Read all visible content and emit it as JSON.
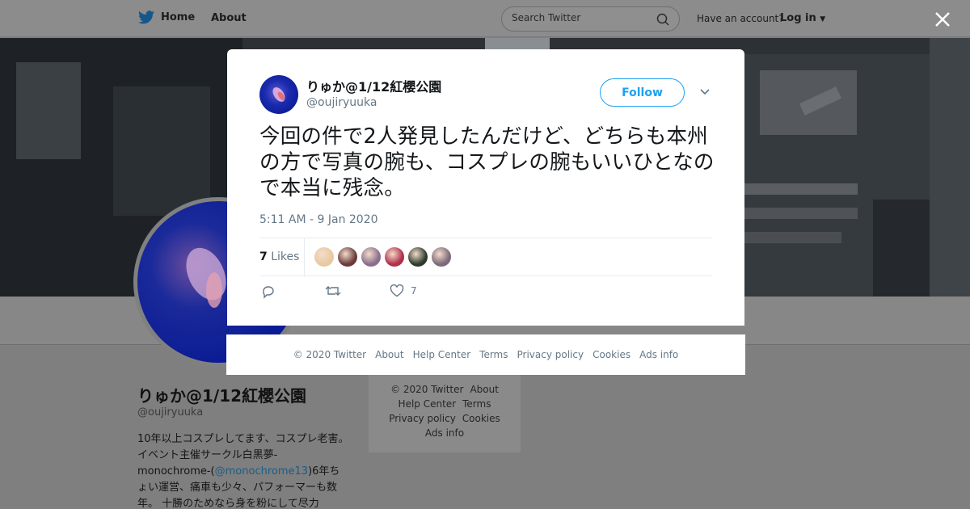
{
  "topbar": {
    "home_label": "Home",
    "about_label": "About",
    "search_placeholder": "Search Twitter",
    "account_prompt": "Have an account?",
    "login_label": "Log in"
  },
  "profile": {
    "name": "りゅか@1/12紅櫻公園",
    "handle": "@oujiryuuka",
    "bio_part1": "10年以上コスプレしてます、コスプレ老害。 イベント主催サークル白黒夢-monochrome-(",
    "bio_link": "@monochrome13",
    "bio_part2": ")6年ちょい運営、痛車も少々、パフォーマーも数年。 十勝のためなら身を粉にして尽力"
  },
  "sidebar_footer": {
    "links": [
      "© 2020 Twitter",
      "About",
      "Help Center",
      "Terms",
      "Privacy policy",
      "Cookies",
      "Ads info"
    ]
  },
  "tweet": {
    "author_name": "りゅか@1/12紅櫻公園",
    "author_handle": "@oujiryuuka",
    "follow_label": "Follow",
    "text": "今回の件で2人発見したんだけど、どちらも本州の方で写真の腕も、コスプレの腕もいいひとなので本当に残念。",
    "timestamp": "5:11 AM - 9 Jan 2020",
    "likes_count": "7",
    "likes_label": "Likes",
    "like_action_count": "7",
    "liker_colors": [
      "#e8c9a0",
      "#6b3a3a",
      "#8a6e8e",
      "#b0304a",
      "#2e3b2c",
      "#7d6a7a"
    ]
  },
  "modal_footer": {
    "links": [
      "© 2020 Twitter",
      "About",
      "Help Center",
      "Terms",
      "Privacy policy",
      "Cookies",
      "Ads info"
    ]
  },
  "colors": {
    "accent": "#1da1f2",
    "secondary_text": "#657786"
  }
}
